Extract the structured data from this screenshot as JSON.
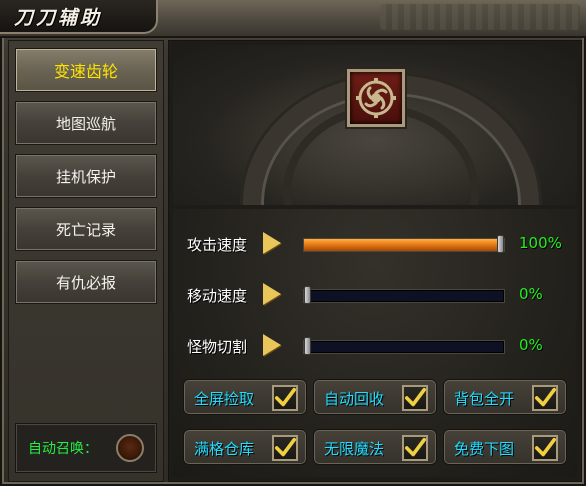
{
  "window": {
    "title": "刀刀辅助"
  },
  "sidebar": {
    "items": [
      {
        "label": "变速齿轮",
        "active": true
      },
      {
        "label": "地图巡航",
        "active": false
      },
      {
        "label": "挂机保护",
        "active": false
      },
      {
        "label": "死亡记录",
        "active": false
      },
      {
        "label": "有仇必报",
        "active": false
      }
    ],
    "auto_summon": {
      "label": "自动召唤：",
      "state": "off"
    }
  },
  "main": {
    "emblem_icon": "gear-icon",
    "sliders": [
      {
        "label": "攻击速度",
        "value_text": "100%",
        "value": 100
      },
      {
        "label": "移动速度",
        "value_text": "0%",
        "value": 0
      },
      {
        "label": "怪物切割",
        "value_text": "0%",
        "value": 0
      }
    ],
    "options": [
      {
        "label": "全屏捡取",
        "checked": true
      },
      {
        "label": "自动回收",
        "checked": true
      },
      {
        "label": "背包全开",
        "checked": true
      },
      {
        "label": "满格仓库",
        "checked": true
      },
      {
        "label": "无限魔法",
        "checked": true
      },
      {
        "label": "免费下图",
        "checked": true
      }
    ]
  },
  "colors": {
    "active_nav_text": "#ffe400",
    "option_text": "#22ddff",
    "percent_text": "#22ee22",
    "slider_fill": "#e07010",
    "auto_summon_text": "#22ee44"
  }
}
